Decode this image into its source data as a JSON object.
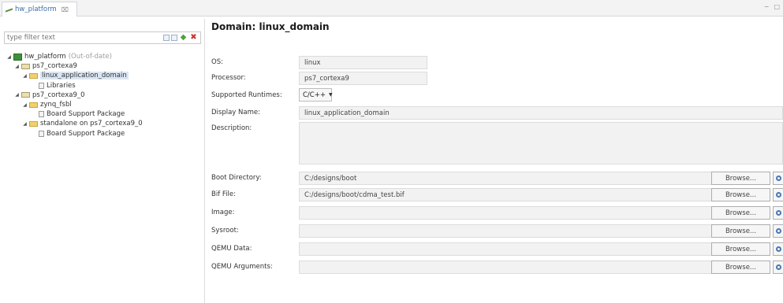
{
  "editor_tab": {
    "title": "hw_platform",
    "close_glyph": "⌧"
  },
  "window_controls": {
    "minimize": "−",
    "maximize": "□"
  },
  "filter": {
    "placeholder": "type filter text",
    "tools": [
      "collapse-all-icon",
      "expand-all-icon",
      "add-icon",
      "remove-icon"
    ]
  },
  "tree": [
    {
      "label": "hw_platform",
      "status": "(Out-of-date)",
      "icon": "platform-icon",
      "level": 0,
      "expanded": true
    },
    {
      "label": "ps7_cortexa9",
      "icon": "processor-icon",
      "level": 1,
      "expanded": true
    },
    {
      "label": "linux_application_domain",
      "icon": "domain-folder-icon",
      "level": 2,
      "expanded": true,
      "selected": true
    },
    {
      "label": "Libraries",
      "icon": "document-icon",
      "level": 3
    },
    {
      "label": "ps7_cortexa9_0",
      "icon": "processor-icon",
      "level": 1,
      "expanded": true
    },
    {
      "label": "zynq_fsbl",
      "icon": "domain-folder-icon",
      "level": 2,
      "expanded": true
    },
    {
      "label": "Board Support Package",
      "icon": "document-icon",
      "level": 3
    },
    {
      "label": "standalone on ps7_cortexa9_0",
      "icon": "domain-folder-icon",
      "level": 2,
      "expanded": true
    },
    {
      "label": "Board Support Package",
      "icon": "document-icon",
      "level": 3
    }
  ],
  "domain": {
    "title": "Domain: linux_domain",
    "os_label": "OS:",
    "os_value": "linux",
    "processor_label": "Processor:",
    "processor_value": "ps7_cortexa9",
    "runtimes_label": "Supported Runtimes:",
    "runtimes_value": "C/C++",
    "display_name_label": "Display Name:",
    "display_name_value": "linux_application_domain",
    "description_label": "Description:",
    "description_value": "",
    "boot_dir_label": "Boot Directory:",
    "boot_dir_value": "C:/designs/boot",
    "bif_label": "Bif File:",
    "bif_value": "C:/designs/boot/cdma_test.bif",
    "image_label": "Image:",
    "image_value": "",
    "sysroot_label": "Sysroot:",
    "sysroot_value": "",
    "qemu_data_label": "QEMU Data:",
    "qemu_data_value": "",
    "qemu_args_label": "QEMU Arguments:",
    "qemu_args_value": "",
    "browse_label": "Browse..."
  }
}
